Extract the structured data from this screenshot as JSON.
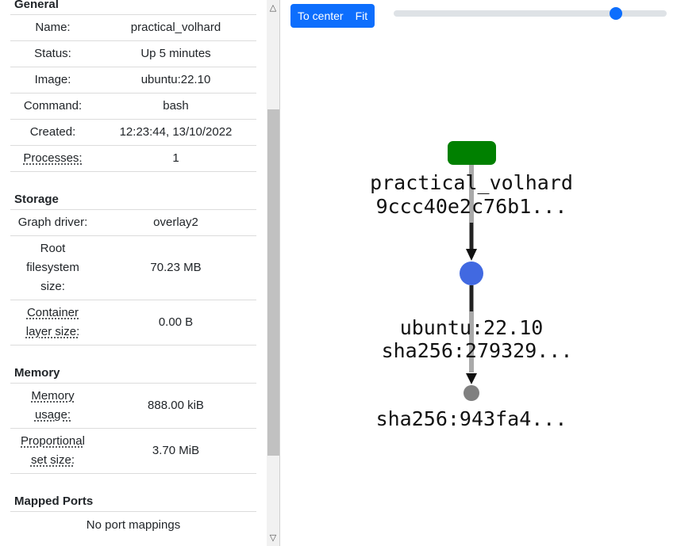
{
  "general": {
    "heading": "General",
    "rows": [
      {
        "label": "Name:",
        "value": "practical_volhard"
      },
      {
        "label": "Status:",
        "value": "Up 5 minutes"
      },
      {
        "label": "Image:",
        "value": "ubuntu:22.10"
      },
      {
        "label": "Command:",
        "value": "bash"
      },
      {
        "label": "Created:",
        "value": "12:23:44, 13/10/2022"
      },
      {
        "label": "Processes:",
        "value": "1"
      }
    ]
  },
  "storage": {
    "heading": "Storage",
    "rows": [
      {
        "label": "Graph driver:",
        "value": "overlay2"
      },
      {
        "label": "Root filesystem size:",
        "value": "70.23 MB"
      },
      {
        "label": "Container layer size:",
        "value": "0.00 B"
      }
    ]
  },
  "memory": {
    "heading": "Memory",
    "rows": [
      {
        "label": "Memory usage:",
        "value": "888.00 kiB"
      },
      {
        "label": "Proportional set size:",
        "value": "3.70 MiB"
      }
    ]
  },
  "ports": {
    "heading": "Mapped Ports",
    "empty_text": "No port mappings"
  },
  "toolbar": {
    "to_center_label": "To center",
    "fit_label": "Fit",
    "zoom_level": 0.83
  },
  "graph": {
    "container_node": {
      "name": "practical_volhard",
      "id": "9ccc40e2c76b1...",
      "color": "#008000"
    },
    "image_node": {
      "name": "ubuntu:22.10",
      "id": "sha256:279329...",
      "color": "#4169e1"
    },
    "layer_node": {
      "id": "sha256:943fa4...",
      "color": "#808080"
    }
  },
  "colors": {
    "accent": "#0d6efd",
    "edge_dark": "#222222",
    "edge_light": "#aaaaaa"
  }
}
